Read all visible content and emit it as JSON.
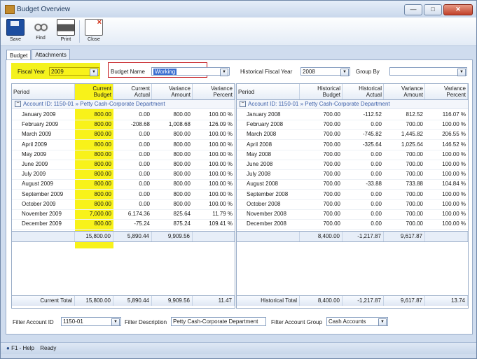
{
  "window": {
    "title": "Budget Overview",
    "buttons": [
      "—",
      "□",
      "✕"
    ]
  },
  "toolbar": {
    "save": "Save",
    "find": "Find",
    "print": "Print",
    "close": "Close"
  },
  "tabs": [
    "Budget",
    "Attachments"
  ],
  "filters": {
    "fiscal_year_label": "Fiscal Year",
    "fiscal_year": "2009",
    "budget_name_label": "Budget Name",
    "budget_name": "Working",
    "hist_year_label": "Historical Fiscal Year",
    "hist_year": "2008",
    "group_by_label": "Group By",
    "group_by": ""
  },
  "left_grid": {
    "headers": [
      [
        "Period"
      ],
      [
        "Current",
        "Budget"
      ],
      [
        "Current",
        "Actual"
      ],
      [
        "Variance",
        "Amount"
      ],
      [
        "Variance",
        "Percent"
      ]
    ],
    "group": "Account ID: 1150-01 » Petty Cash-Corporate Department",
    "rows": [
      [
        "January 2009",
        "800.00",
        "0.00",
        "800.00",
        "100.00 %"
      ],
      [
        "February 2009",
        "800.00",
        "-208.68",
        "1,008.68",
        "126.09 %"
      ],
      [
        "March 2009",
        "800.00",
        "0.00",
        "800.00",
        "100.00 %"
      ],
      [
        "April 2009",
        "800.00",
        "0.00",
        "800.00",
        "100.00 %"
      ],
      [
        "May 2009",
        "800.00",
        "0.00",
        "800.00",
        "100.00 %"
      ],
      [
        "June 2009",
        "800.00",
        "0.00",
        "800.00",
        "100.00 %"
      ],
      [
        "July 2009",
        "800.00",
        "0.00",
        "800.00",
        "100.00 %"
      ],
      [
        "August 2009",
        "800.00",
        "0.00",
        "800.00",
        "100.00 %"
      ],
      [
        "September 2009",
        "800.00",
        "0.00",
        "800.00",
        "100.00 %"
      ],
      [
        "October 2009",
        "800.00",
        "0.00",
        "800.00",
        "100.00 %"
      ],
      [
        "November 2009",
        "7,000.00",
        "6,174.36",
        "825.64",
        "11.79 %"
      ],
      [
        "December 2009",
        "800.00",
        "-75.24",
        "875.24",
        "109.41 %"
      ]
    ],
    "summary": [
      "",
      "15,800.00",
      "5,890.44",
      "9,909.56",
      ""
    ],
    "total": [
      "Current Total",
      "15,800.00",
      "5,890.44",
      "9,909.56",
      "11.47"
    ]
  },
  "right_grid": {
    "headers": [
      [
        "Period"
      ],
      [
        "Historical",
        "Budget"
      ],
      [
        "Historical",
        "Actual"
      ],
      [
        "Variance",
        "Amount"
      ],
      [
        "Variance",
        "Percent"
      ]
    ],
    "group": "Account ID: 1150-01 » Petty Cash-Corporate Department",
    "rows": [
      [
        "January 2008",
        "700.00",
        "-112.52",
        "812.52",
        "116.07 %"
      ],
      [
        "February 2008",
        "700.00",
        "0.00",
        "700.00",
        "100.00 %"
      ],
      [
        "March 2008",
        "700.00",
        "-745.82",
        "1,445.82",
        "206.55 %"
      ],
      [
        "April 2008",
        "700.00",
        "-325.64",
        "1,025.64",
        "146.52 %"
      ],
      [
        "May 2008",
        "700.00",
        "0.00",
        "700.00",
        "100.00 %"
      ],
      [
        "June 2008",
        "700.00",
        "0.00",
        "700.00",
        "100.00 %"
      ],
      [
        "July 2008",
        "700.00",
        "0.00",
        "700.00",
        "100.00 %"
      ],
      [
        "August 2008",
        "700.00",
        "-33.88",
        "733.88",
        "104.84 %"
      ],
      [
        "September 2008",
        "700.00",
        "0.00",
        "700.00",
        "100.00 %"
      ],
      [
        "October 2008",
        "700.00",
        "0.00",
        "700.00",
        "100.00 %"
      ],
      [
        "November 2008",
        "700.00",
        "0.00",
        "700.00",
        "100.00 %"
      ],
      [
        "December 2008",
        "700.00",
        "0.00",
        "700.00",
        "100.00 %"
      ]
    ],
    "summary": [
      "",
      "8,400.00",
      "-1,217.87",
      "9,617.87",
      ""
    ],
    "total": [
      "Historical Total",
      "8,400.00",
      "-1,217.87",
      "9,617.87",
      "13.74"
    ]
  },
  "bottom": {
    "account_label": "Filter Account ID",
    "account": "1150-01",
    "desc_label": "Filter Description",
    "desc": "Petty Cash-Corporate Department",
    "group_label": "Filter Account Group",
    "group": "Cash Accounts"
  },
  "status": {
    "help": "F1 - Help",
    "state": "Ready"
  },
  "colors": {
    "highlight": "#f8f21a",
    "annotation_box": "#c3141a"
  }
}
